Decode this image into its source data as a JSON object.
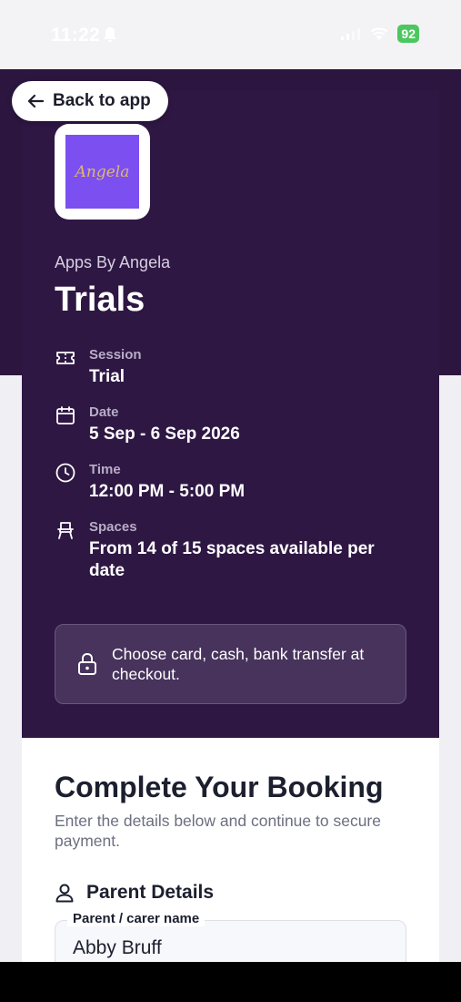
{
  "status_bar": {
    "time": "11:22",
    "battery": "92"
  },
  "back_button": {
    "label": "Back to app"
  },
  "provider": {
    "name": "Apps By Angela",
    "logo_text": "Angela"
  },
  "page_title": "Trials",
  "details": {
    "session": {
      "label": "Session",
      "value": "Trial",
      "icon": "ticket-icon"
    },
    "date": {
      "label": "Date",
      "value": "5 Sep - 6 Sep 2026",
      "icon": "calendar-icon"
    },
    "time": {
      "label": "Time",
      "value": "12:00 PM - 5:00 PM",
      "icon": "clock-icon"
    },
    "spaces": {
      "label": "Spaces",
      "value": "From 14 of 15 spaces available per date",
      "icon": "chair-icon"
    }
  },
  "payment_notice": {
    "text": "Choose card, cash, bank transfer at checkout.",
    "icon": "lock-icon"
  },
  "booking": {
    "title": "Complete Your Booking",
    "subtitle": "Enter the details below and continue to secure payment.",
    "parent_section": "Parent Details",
    "parent_field": {
      "label": "Parent / carer name",
      "value": "Abby Bruff"
    }
  },
  "colors": {
    "header_bg": "#2c1640",
    "card_bg": "#2f1744",
    "logo_bg": "#7b4ff0",
    "battery": "#4cc75f"
  }
}
